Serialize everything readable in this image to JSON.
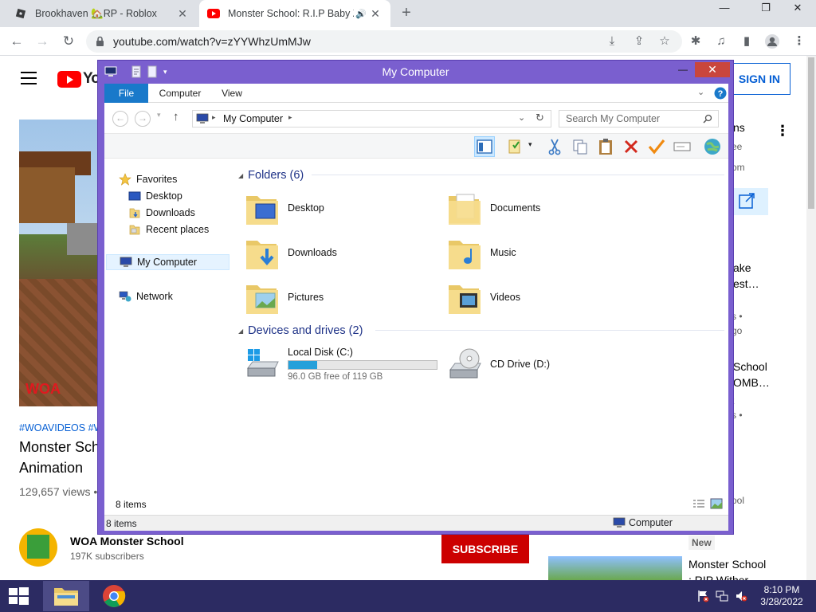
{
  "browser": {
    "tabs": [
      {
        "title": "Brookhaven 🏡RP - Roblox",
        "active": false
      },
      {
        "title": "Monster School: R.I.P Baby Z",
        "active": true
      }
    ],
    "new_tab": "+",
    "window_controls": {
      "minimize": "—",
      "restore": "❐",
      "close": "✕"
    },
    "url": "youtube.com/watch?v=zYYWhzUmMJw"
  },
  "youtube": {
    "logo_text": "YouTube",
    "sign_in": "SIGN IN",
    "hashtags": "#WOAVIDEOS #WO",
    "title_line1": "Monster Sch",
    "title_line2": "Animation",
    "views": "129,657 views •",
    "watermark": "WOA",
    "channel_name": "WOA Monster School",
    "subscribers": "197K subscribers",
    "subscribe": "SUBSCRIBE",
    "sidebar_fragments": {
      "a": "ns",
      "b": "ee",
      "c": "om",
      "d": "ake",
      "e": "est…",
      "f": "s •",
      "g": "go",
      "h": "School",
      "i": "OMB…",
      "j": "t",
      "k": "s •",
      "l": "ool"
    },
    "new_badge": "New",
    "next_title_1": "Monster School",
    "next_title_2": ": RIP Wither"
  },
  "explorer": {
    "title": "My Computer",
    "ribbon_tabs": [
      "File",
      "Computer",
      "View"
    ],
    "address": "My Computer",
    "search_placeholder": "Search My Computer",
    "nav": {
      "favorites": "Favorites",
      "desktop": "Desktop",
      "downloads": "Downloads",
      "recent": "Recent places",
      "my_computer": "My Computer",
      "network": "Network"
    },
    "folders_header": "Folders (6)",
    "folders": [
      "Desktop",
      "Documents",
      "Downloads",
      "Music",
      "Pictures",
      "Videos"
    ],
    "drives_header": "Devices and drives (2)",
    "drives": [
      {
        "name": "Local Disk (C:)",
        "free": "96.0 GB free of 119 GB",
        "used_fraction": 0.193
      },
      {
        "name": "CD Drive (D:)"
      }
    ],
    "item_count": "8 items",
    "status_count": "8 items",
    "status_location": "Computer"
  },
  "taskbar": {
    "time": "8:10 PM",
    "date": "3/28/2022"
  }
}
